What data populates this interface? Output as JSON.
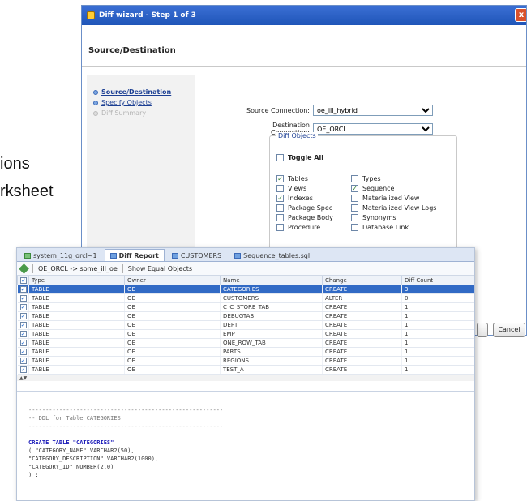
{
  "slide": {
    "line1": "ions",
    "line2": "rksheet"
  },
  "wizard": {
    "title": "Diff wizard - Step 1 of 3",
    "close_label": "x",
    "header": "Source/Destination",
    "steps": [
      {
        "label": "Source/Destination",
        "state": "active"
      },
      {
        "label": "Specify Objects",
        "state": "link"
      },
      {
        "label": "Diff Summary",
        "state": "disabled"
      }
    ],
    "source_label": "Source Connection:",
    "source_value": "oe_ill_hybrid",
    "dest_label": "Destination Connection:",
    "dest_value": "OE_ORCL",
    "group_title": "Diff Objects",
    "toggle_all": "Toggle All",
    "objects_left": [
      {
        "label": "Tables",
        "checked": true
      },
      {
        "label": "Views",
        "checked": false
      },
      {
        "label": "Indexes",
        "checked": true
      },
      {
        "label": "Package Spec",
        "checked": false
      },
      {
        "label": "Package Body",
        "checked": false
      },
      {
        "label": "Procedure",
        "checked": false
      }
    ],
    "objects_right": [
      {
        "label": "Types",
        "checked": false
      },
      {
        "label": "Sequence",
        "checked": true
      },
      {
        "label": "Materialized View",
        "checked": false
      },
      {
        "label": "Materialized View Logs",
        "checked": false
      },
      {
        "label": "Synonyms",
        "checked": false
      },
      {
        "label": "Database Link",
        "checked": false
      }
    ],
    "cancel_label": "Cancel"
  },
  "report": {
    "tabs": [
      {
        "label": "system_11g_orcl~1",
        "active": false
      },
      {
        "label": "Diff Report",
        "active": true
      },
      {
        "label": "CUSTOMERS",
        "active": false
      },
      {
        "label": "Sequence_tables.sql",
        "active": false
      }
    ],
    "toolbar": {
      "compare_label": "OE_ORCL -> some_ill_oe",
      "show_equal": "Show Equal Objects"
    },
    "columns": [
      "Type",
      "Owner",
      "Name",
      "Change",
      "Diff Count"
    ],
    "rows": [
      {
        "type": "TABLE",
        "owner": "OE",
        "name": "CATEGORIES",
        "change": "CREATE",
        "count": "3",
        "selected": true
      },
      {
        "type": "TABLE",
        "owner": "OE",
        "name": "CUSTOMERS",
        "change": "ALTER",
        "count": "0",
        "selected": false
      },
      {
        "type": "TABLE",
        "owner": "OE",
        "name": "C_C_STORE_TAB",
        "change": "CREATE",
        "count": "1",
        "selected": false
      },
      {
        "type": "TABLE",
        "owner": "OE",
        "name": "DEBUGTAB",
        "change": "CREATE",
        "count": "1",
        "selected": false
      },
      {
        "type": "TABLE",
        "owner": "OE",
        "name": "DEPT",
        "change": "CREATE",
        "count": "1",
        "selected": false
      },
      {
        "type": "TABLE",
        "owner": "OE",
        "name": "EMP",
        "change": "CREATE",
        "count": "1",
        "selected": false
      },
      {
        "type": "TABLE",
        "owner": "OE",
        "name": "ONE_ROW_TAB",
        "change": "CREATE",
        "count": "1",
        "selected": false
      },
      {
        "type": "TABLE",
        "owner": "OE",
        "name": "PARTS",
        "change": "CREATE",
        "count": "1",
        "selected": false
      },
      {
        "type": "TABLE",
        "owner": "OE",
        "name": "REGIONS",
        "change": "CREATE",
        "count": "1",
        "selected": false
      },
      {
        "type": "TABLE",
        "owner": "OE",
        "name": "TEST_A",
        "change": "CREATE",
        "count": "1",
        "selected": false
      }
    ],
    "ddl": {
      "divider1": "---------------------------------------------------------",
      "comment": "-- DDL for Table CATEGORIES",
      "divider2": "---------------------------------------------------------",
      "line1": "CREATE TABLE \"CATEGORIES\"",
      "line2": "  (  \"CATEGORY_NAME\" VARCHAR2(50),",
      "line3": "\"CATEGORY_DESCRIPTION\" VARCHAR2(1000),",
      "line4": "\"CATEGORY_ID\" NUMBER(2,0)",
      "line5": "  ) ;"
    }
  }
}
